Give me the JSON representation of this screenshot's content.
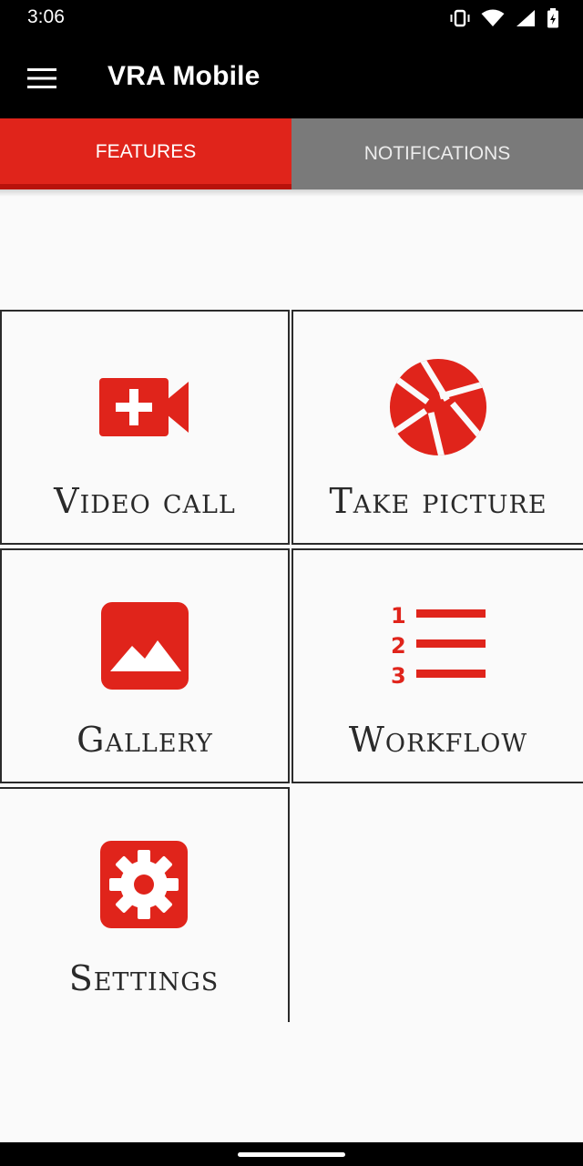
{
  "status_bar": {
    "time": "3:06",
    "icons": [
      "vibrate-icon",
      "wifi-icon",
      "signal-icon",
      "battery-icon"
    ]
  },
  "app_bar": {
    "title": "VRA Mobile",
    "menu_icon": "menu-icon"
  },
  "tabs": [
    {
      "label": "FEATURES",
      "selected": true
    },
    {
      "label": "NOTIFICATIONS",
      "selected": false
    }
  ],
  "features": [
    {
      "label": "Video call",
      "icon": "video-call-icon"
    },
    {
      "label": "Take picture",
      "icon": "camera-shutter-icon"
    },
    {
      "label": "Gallery",
      "icon": "gallery-icon"
    },
    {
      "label": "Workflow",
      "icon": "workflow-list-icon"
    },
    {
      "label": "Settings",
      "icon": "settings-gear-icon"
    }
  ],
  "colors": {
    "accent": "#e0241b",
    "tab_inactive": "#7a7a7a",
    "bar_background": "#000000",
    "page_background": "#fafafa"
  }
}
